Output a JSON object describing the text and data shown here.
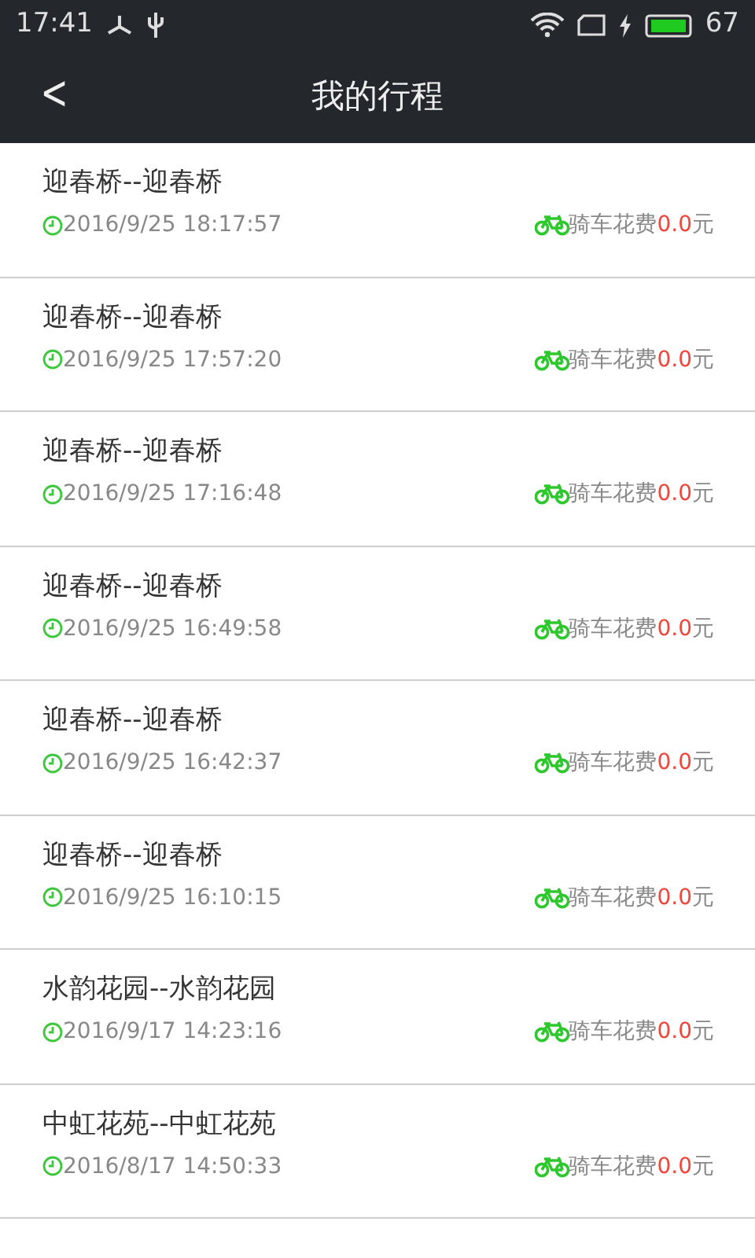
{
  "status_bar": {
    "time": "17:41",
    "battery_percent": "67"
  },
  "header": {
    "back": "<",
    "title": "我的行程"
  },
  "trips": [
    {
      "route": "迎春桥--迎春桥",
      "datetime": "2016/9/25 18:17:57",
      "cost_label": "骑车花费",
      "cost_amount": "0.0",
      "cost_unit": "元"
    },
    {
      "route": "迎春桥--迎春桥",
      "datetime": "2016/9/25 17:57:20",
      "cost_label": "骑车花费",
      "cost_amount": "0.0",
      "cost_unit": "元"
    },
    {
      "route": "迎春桥--迎春桥",
      "datetime": "2016/9/25 17:16:48",
      "cost_label": "骑车花费",
      "cost_amount": "0.0",
      "cost_unit": "元"
    },
    {
      "route": "迎春桥--迎春桥",
      "datetime": "2016/9/25 16:49:58",
      "cost_label": "骑车花费",
      "cost_amount": "0.0",
      "cost_unit": "元"
    },
    {
      "route": "迎春桥--迎春桥",
      "datetime": "2016/9/25 16:42:37",
      "cost_label": "骑车花费",
      "cost_amount": "0.0",
      "cost_unit": "元"
    },
    {
      "route": "迎春桥--迎春桥",
      "datetime": "2016/9/25 16:10:15",
      "cost_label": "骑车花费",
      "cost_amount": "0.0",
      "cost_unit": "元"
    },
    {
      "route": "水韵花园--水韵花园",
      "datetime": "2016/9/17 14:23:16",
      "cost_label": "骑车花费",
      "cost_amount": "0.0",
      "cost_unit": "元"
    },
    {
      "route": "中虹花苑--中虹花苑",
      "datetime": "2016/8/17 14:50:33",
      "cost_label": "骑车花费",
      "cost_amount": "0.0",
      "cost_unit": "元"
    }
  ]
}
